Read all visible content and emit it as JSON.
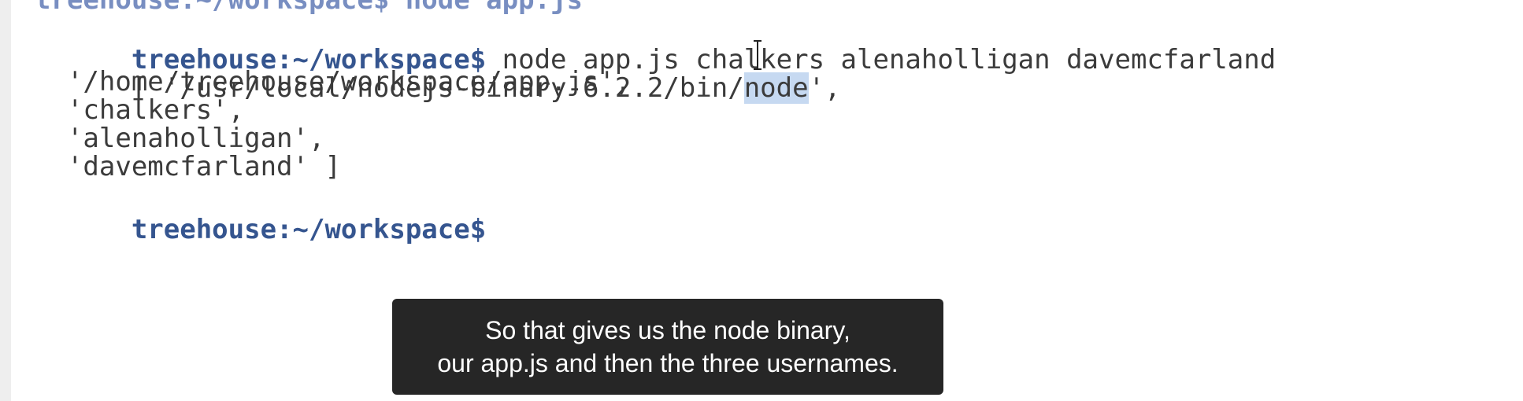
{
  "terminal": {
    "partial_top_line": "treehouse:~/workspace$ node app.js",
    "prompt": "treehouse:~/workspace$",
    "command": " node app.js chalkers alenaholligan davemcfarland",
    "output": {
      "line1_pre": "[ '/usr/local/nodejs-binary-6.2.2/bin/",
      "line1_hl": "node",
      "line1_post": "',",
      "line2": "  '/home/treehouse/workspace/app.js',",
      "line3": "  'chalkers',",
      "line4": "  'alenaholligan',",
      "line5": "  'davemcfarland' ]"
    },
    "final_prompt": "treehouse:~/workspace$"
  },
  "caption": {
    "line1": "So that gives us the node binary,",
    "line2": "our app.js and then the three usernames."
  },
  "colors": {
    "prompt": "#35558f",
    "text": "#3b3b3b",
    "selection": "#c6d9f1",
    "caption_bg": "#262626"
  },
  "icons": {
    "cursor": "text-cursor-icon"
  }
}
